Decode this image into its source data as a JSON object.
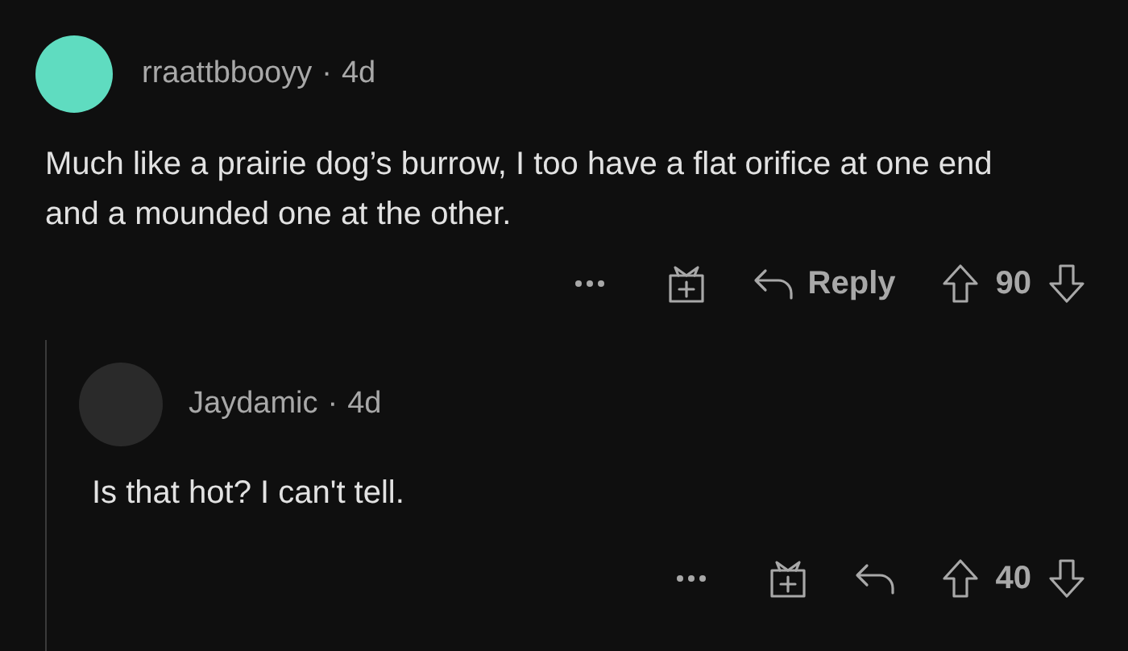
{
  "comments": [
    {
      "user": "rraattbbooyy",
      "separator": "·",
      "age": "4d",
      "body": "Much like a prairie dog’s burrow, I too have a flat orifice at one end and a mounded one at the other.",
      "reply_label": "Reply",
      "score": "90",
      "replies": [
        {
          "user": "Jaydamic",
          "separator": "·",
          "age": "4d",
          "body": "Is that hot? I can't tell.",
          "score": "40"
        }
      ]
    }
  ]
}
